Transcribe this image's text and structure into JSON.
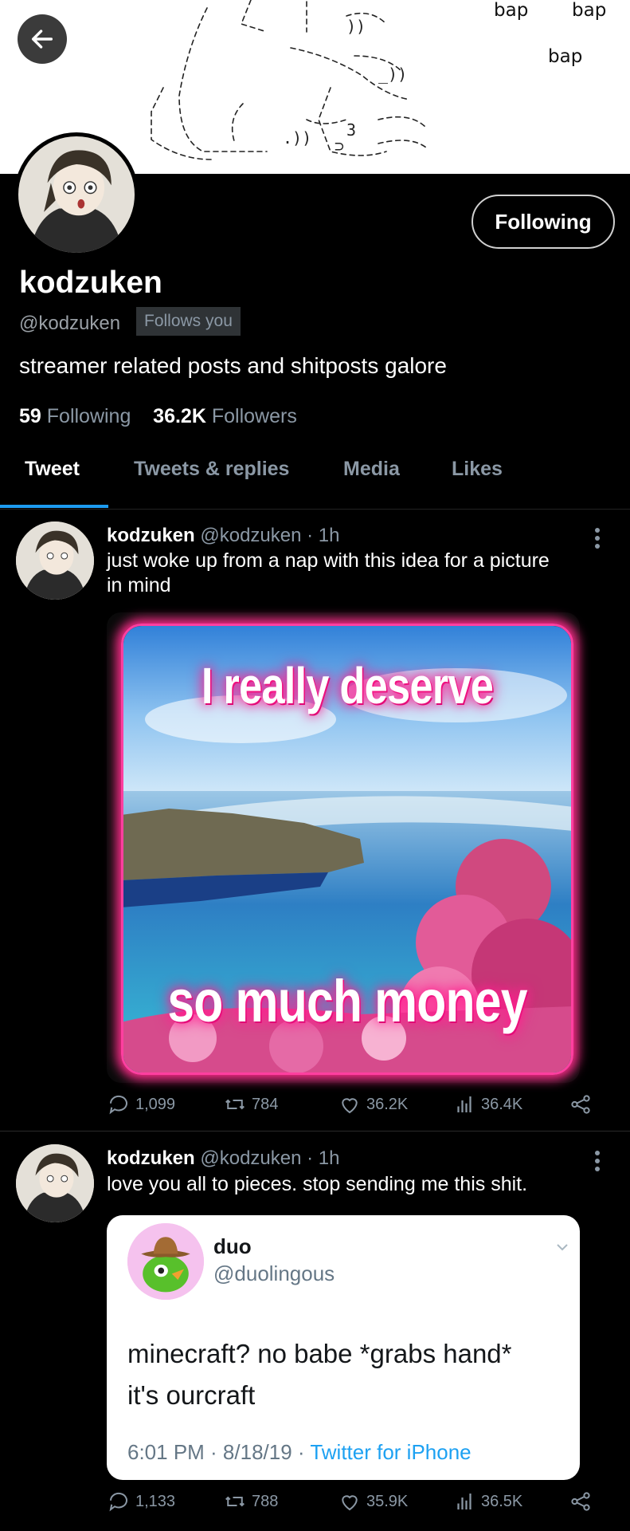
{
  "header": {
    "back_icon": "arrow-left-icon",
    "banner_words": [
      "bap",
      "bap",
      "bap"
    ]
  },
  "profile": {
    "display_name": "kodzuken",
    "handle": "@kodzuken",
    "follows_you": "Follows you",
    "bio": "streamer related posts and shitposts galore",
    "follow_button": "Following",
    "following_count": "59",
    "following_label": "Following",
    "followers_count": "36.2K",
    "followers_label": "Followers"
  },
  "tabs": [
    {
      "label": "Tweet",
      "active": true
    },
    {
      "label": "Tweets & replies",
      "active": false
    },
    {
      "label": "Media",
      "active": false
    },
    {
      "label": "Likes",
      "active": false
    }
  ],
  "tweets": [
    {
      "name": "kodzuken",
      "meta": "@kodzuken · 1h",
      "text_line1": "just woke up from a nap with this idea for a picture",
      "text_line2": "in mind",
      "image": {
        "top_text": "I really deserve",
        "bottom_text": "so much money"
      },
      "replies": "1,099",
      "retweets": "784",
      "likes": "36.2K",
      "views": "36.4K"
    },
    {
      "name": "kodzuken",
      "meta": "@kodzuken · 1h",
      "text_line1": "love you all to pieces. stop sending me this shit.",
      "quote": {
        "name": "duo",
        "handle": "@duolingous",
        "text_line1": "minecraft? no babe *grabs hand*",
        "text_line2": "it's ourcraft",
        "time": "6:01 PM · 8/18/19 · ",
        "source": "Twitter for iPhone"
      },
      "replies": "1,133",
      "retweets": "788",
      "likes": "35.9K",
      "views": "36.5K"
    }
  ],
  "colors": {
    "accent": "#1d9bf0",
    "muted": "#8b98a5",
    "glow": "#ff2d8c"
  }
}
